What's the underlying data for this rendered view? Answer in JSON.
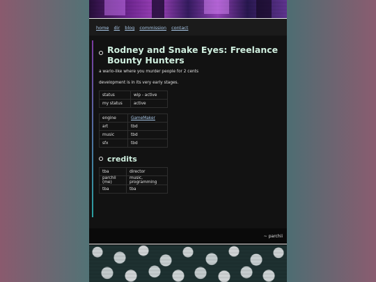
{
  "nav": {
    "links": [
      "home",
      "dir",
      "blog",
      "commission",
      "contact"
    ]
  },
  "main": {
    "title": "Rodney and Snake Eyes: Freelance Bounty Hunters",
    "tagline": "a wario-like where you murder people for 2 cents",
    "note": "development is in its very early stages.",
    "status_table": [
      [
        "status",
        "wip - active"
      ],
      [
        "my status",
        "active"
      ]
    ],
    "tools_table": [
      [
        "engine",
        "GameMaker"
      ],
      [
        "art",
        "tbd"
      ],
      [
        "music",
        "tbd"
      ],
      [
        "sfx",
        "tbd"
      ]
    ],
    "credits_heading": "credits",
    "credits_table": [
      [
        "tba",
        "director"
      ],
      [
        "parchii (me)",
        "music, programming"
      ],
      [
        "tba",
        "tba"
      ]
    ]
  },
  "footer": {
    "signature": "~ parchii"
  },
  "colors": {
    "page_bg": "#121212",
    "heading": "#cfeede",
    "link": "#a9c8e8"
  }
}
